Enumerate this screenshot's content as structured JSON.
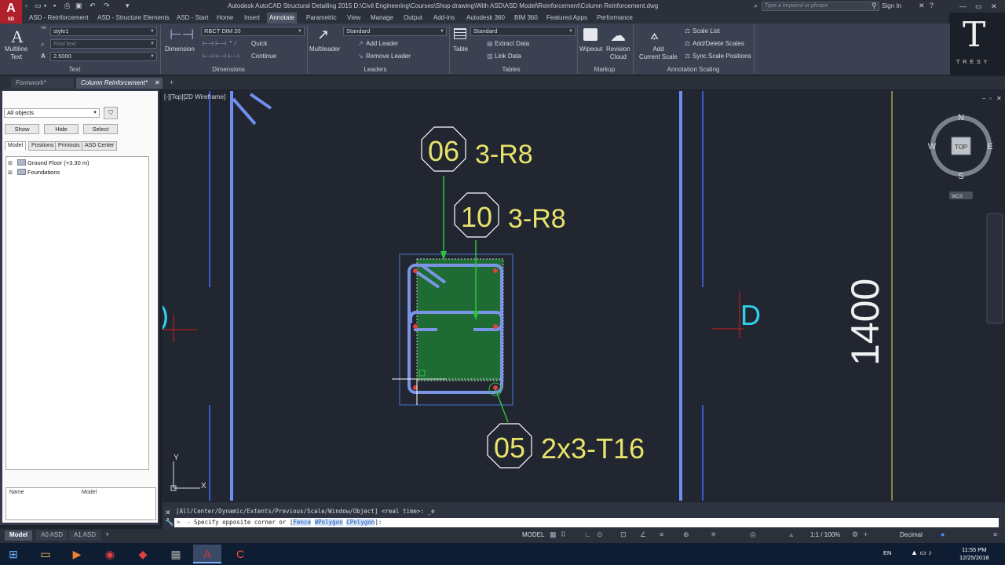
{
  "window": {
    "title": "Autodesk AutoCAD Structural Detailing 2015   D:\\Civil Engineering\\Courses\\Shop drawing\\With ASD\\ASD Model\\Reinforcement\\Column Reinforcement.dwg",
    "search_placeholder": "Type a keyword or phrase",
    "sign_in": "Sign In",
    "app_letter": "A",
    "app_badge": "SD"
  },
  "ribbon_tabs": [
    "ASD - Reinforcement",
    "ASD - Structure Elements",
    "ASD - Start",
    "Home",
    "Insert",
    "Annotate",
    "Parametric",
    "View",
    "Manage",
    "Output",
    "Add-ins",
    "Autodesk 360",
    "BIM 360",
    "Featured Apps",
    "Performance"
  ],
  "active_ribbon_tab": "Annotate",
  "ribbon": {
    "text_panel": {
      "title": "Text",
      "multiline_text": "Multiline\nText",
      "style_value": "style1",
      "find_text_placeholder": "Find text",
      "height_value": "2.5000"
    },
    "dimensions_panel": {
      "title": "Dimensions",
      "dimension_label": "Dimension",
      "dim_style": "RBCT DIM 20",
      "quick": "Quick",
      "continue": "Continue"
    },
    "leaders_panel": {
      "title": "Leaders",
      "multileader": "Multileader",
      "style": "Standard",
      "add_leader": "Add Leader",
      "remove_leader": "Remove Leader"
    },
    "tables_panel": {
      "title": "Tables",
      "table": "Table",
      "style": "Standard",
      "extract_data": "Extract Data",
      "link_data": "Link Data"
    },
    "markup_panel": {
      "title": "Markup",
      "wipeout": "Wipeout",
      "revision_cloud": "Revision\nCloud"
    },
    "scaling_panel": {
      "title": "Annotation Scaling",
      "add_current_scale": "Add\nCurrent Scale",
      "scale_list": "Scale List",
      "add_delete_scales": "Add/Delete Scales",
      "sync_scale_positions": "Sync Scale Positions"
    }
  },
  "logo": {
    "letter": "T",
    "text": "TRESY"
  },
  "doc_tabs": [
    "Formwork*",
    "Column Reinforcement*"
  ],
  "active_doc_tab": "Column Reinforcement*",
  "left_panel": {
    "filter_value": "All objects",
    "buttons": [
      "Show",
      "Hide",
      "Select"
    ],
    "tabs": [
      "Model",
      "Positions",
      "Printouts",
      "ASD Center"
    ],
    "tree": [
      "Ground Floor (+3.30 m)",
      "Foundations"
    ],
    "prop_headers": [
      "Name",
      "Model"
    ]
  },
  "viewport": {
    "label": "[-][Top][2D Wireframe]",
    "viewcube": {
      "n": "N",
      "s": "S",
      "e": "E",
      "w": "W",
      "top": "TOP",
      "wcs": "WCS"
    },
    "annotations": [
      {
        "mark": "06",
        "text": "3-R8"
      },
      {
        "mark": "10",
        "text": "3-R8"
      },
      {
        "mark": "05",
        "text": "2x3-T16"
      }
    ],
    "dimension_text": "1400",
    "axis_label_right": "D",
    "ucs_x": "X",
    "ucs_y": "Y"
  },
  "command_line": {
    "history": "[All/Center/Dynamic/Extents/Previous/Scale/Window/Object] <real time>: _e",
    "prompt_prefix": "- Specify opposite corner or [",
    "options": [
      "Fence",
      "WPolygon",
      "CPolygon"
    ],
    "prompt_suffix": "]:"
  },
  "layout_tabs": [
    "Model",
    "A0 ASD",
    "A1 ASD"
  ],
  "status_bar": {
    "model": "MODEL",
    "scale": "1:1 / 100%",
    "units": "Decimal"
  },
  "taskbar": {
    "lang": "EN",
    "time": "11:55 PM",
    "date": "12/25/2018"
  },
  "colors": {
    "background": "#212631",
    "rebar": "#7b95e6",
    "annotation_text": "#e8e36a",
    "leader": "#30c040",
    "column_fill": "#1e6b33"
  }
}
